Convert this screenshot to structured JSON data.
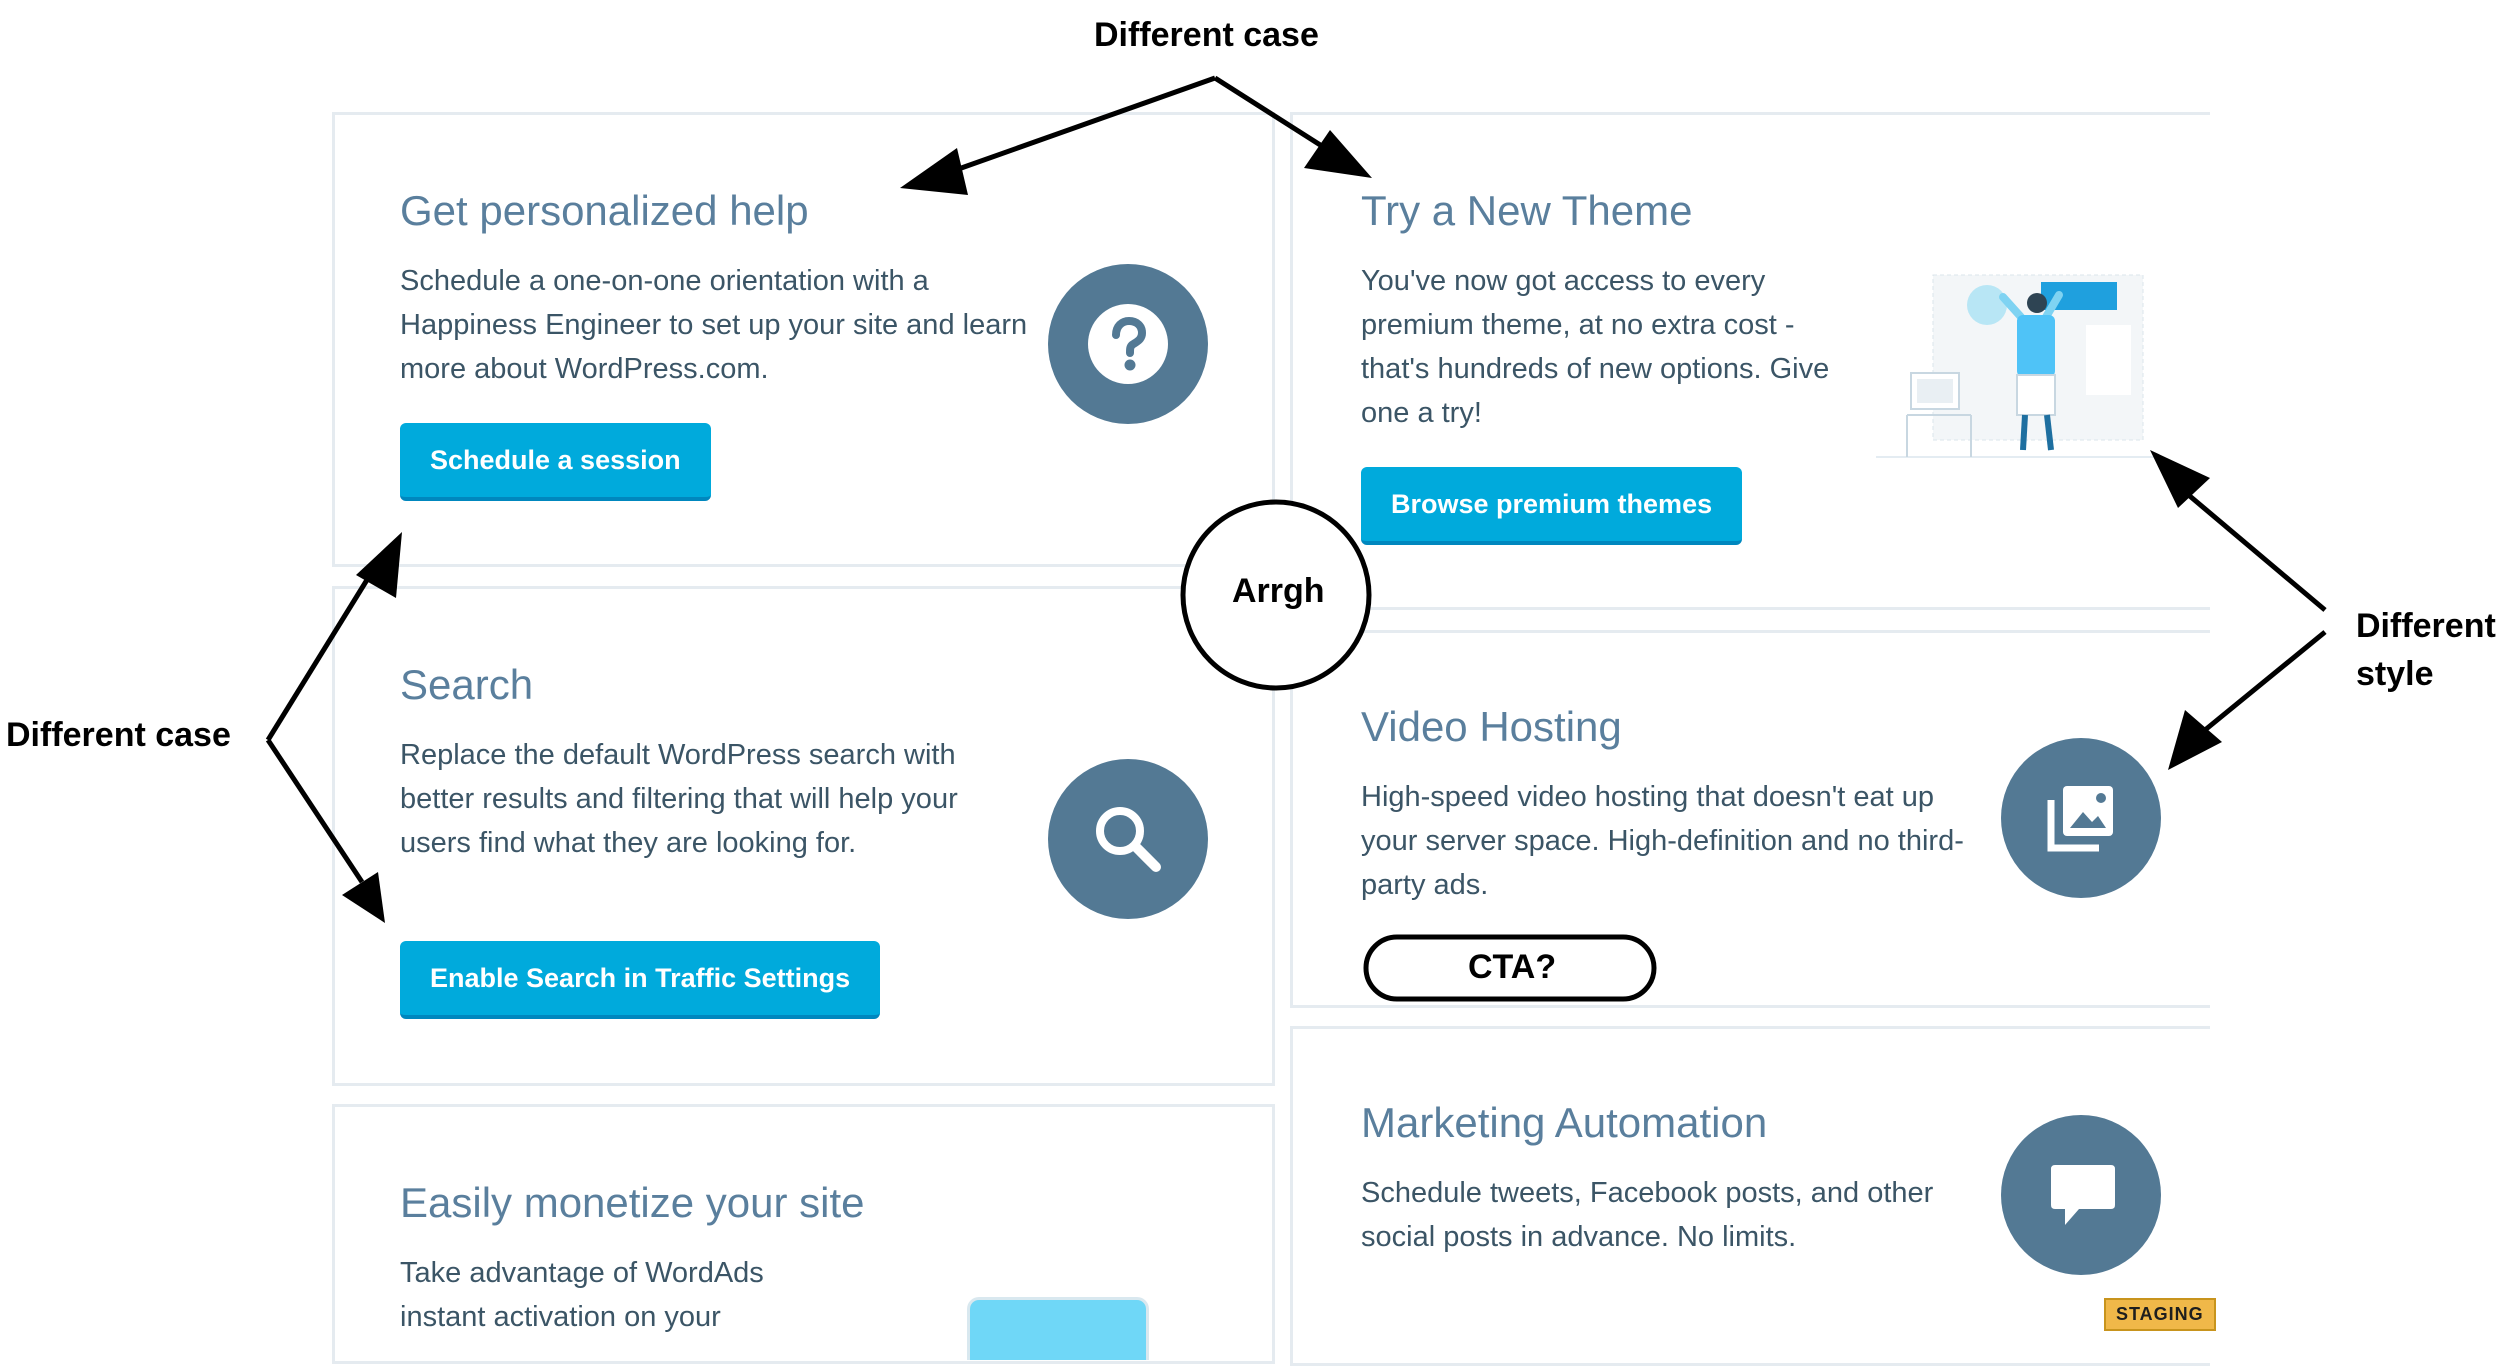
{
  "cards": {
    "help": {
      "title": "Get personalized help",
      "description": "Schedule a one-on-one orientation with a Happiness Engineer to set up your site and learn more about WordPress.com.",
      "button": "Schedule a session",
      "icon": "question-icon"
    },
    "search": {
      "title": "Search",
      "description": "Replace the default WordPress search with better results and filtering that will help your users find what they are looking for.",
      "button": "Enable Search in Traffic Settings",
      "icon": "search-icon"
    },
    "monetize": {
      "title": "Easily monetize your site",
      "description": "Take advantage of WordAds instant activation on your"
    },
    "theme": {
      "title": "Try a New Theme",
      "description": "You've now got access to every premium theme, at no extra cost - that's hundreds of new options. Give one a try!",
      "button": "Browse premium themes",
      "illustration": "person-designing-illustration"
    },
    "video": {
      "title": "Video Hosting",
      "description": "High-speed video hosting that doesn't eat up your server space. High-definition and no third-party ads.",
      "icon": "image-gallery-icon"
    },
    "marketing": {
      "title": "Marketing Automation",
      "description": "Schedule tweets, Facebook posts, and other social posts in advance. No limits.",
      "icon": "speech-bubble-icon"
    }
  },
  "annotations": {
    "top": "Different case",
    "left": "Different case",
    "center": "Arrgh",
    "right_line1": "Different",
    "right_line2": "style",
    "cta": "CTA?"
  },
  "staging_badge": "STAGING",
  "colors": {
    "accent": "#00aadc",
    "accent_border": "#0087be",
    "icon_bg": "#537994",
    "title": "#5a7f9d",
    "text": "#3b5566",
    "card_border": "#e5ebf0"
  }
}
